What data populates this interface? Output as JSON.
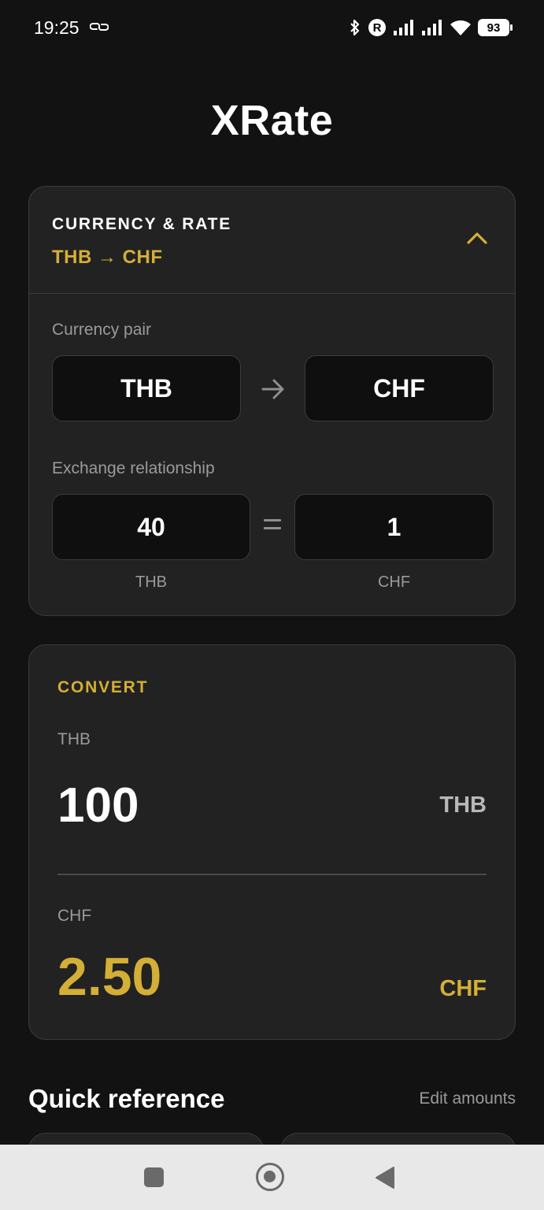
{
  "theme": {
    "background": "#121212",
    "accent": "#d4af37"
  },
  "status_bar": {
    "time": "19:25",
    "battery": "93",
    "carrier_badge": "R"
  },
  "app": {
    "title": "XRate"
  },
  "rate_section": {
    "title": "CURRENCY & RATE",
    "summary": "THB → CHF",
    "currency_pair_label": "Currency pair",
    "from_currency": "THB",
    "to_currency": "CHF",
    "relationship_label": "Exchange relationship",
    "from_amount": "40",
    "to_amount": "1",
    "from_unit": "THB",
    "to_unit": "CHF"
  },
  "convert_section": {
    "title": "CONVERT",
    "input_label": "THB",
    "input_value": "100",
    "input_unit": "THB",
    "output_label": "CHF",
    "output_value": "2.50",
    "output_unit": "CHF"
  },
  "quick_reference": {
    "title": "Quick reference",
    "edit_label": "Edit amounts"
  }
}
